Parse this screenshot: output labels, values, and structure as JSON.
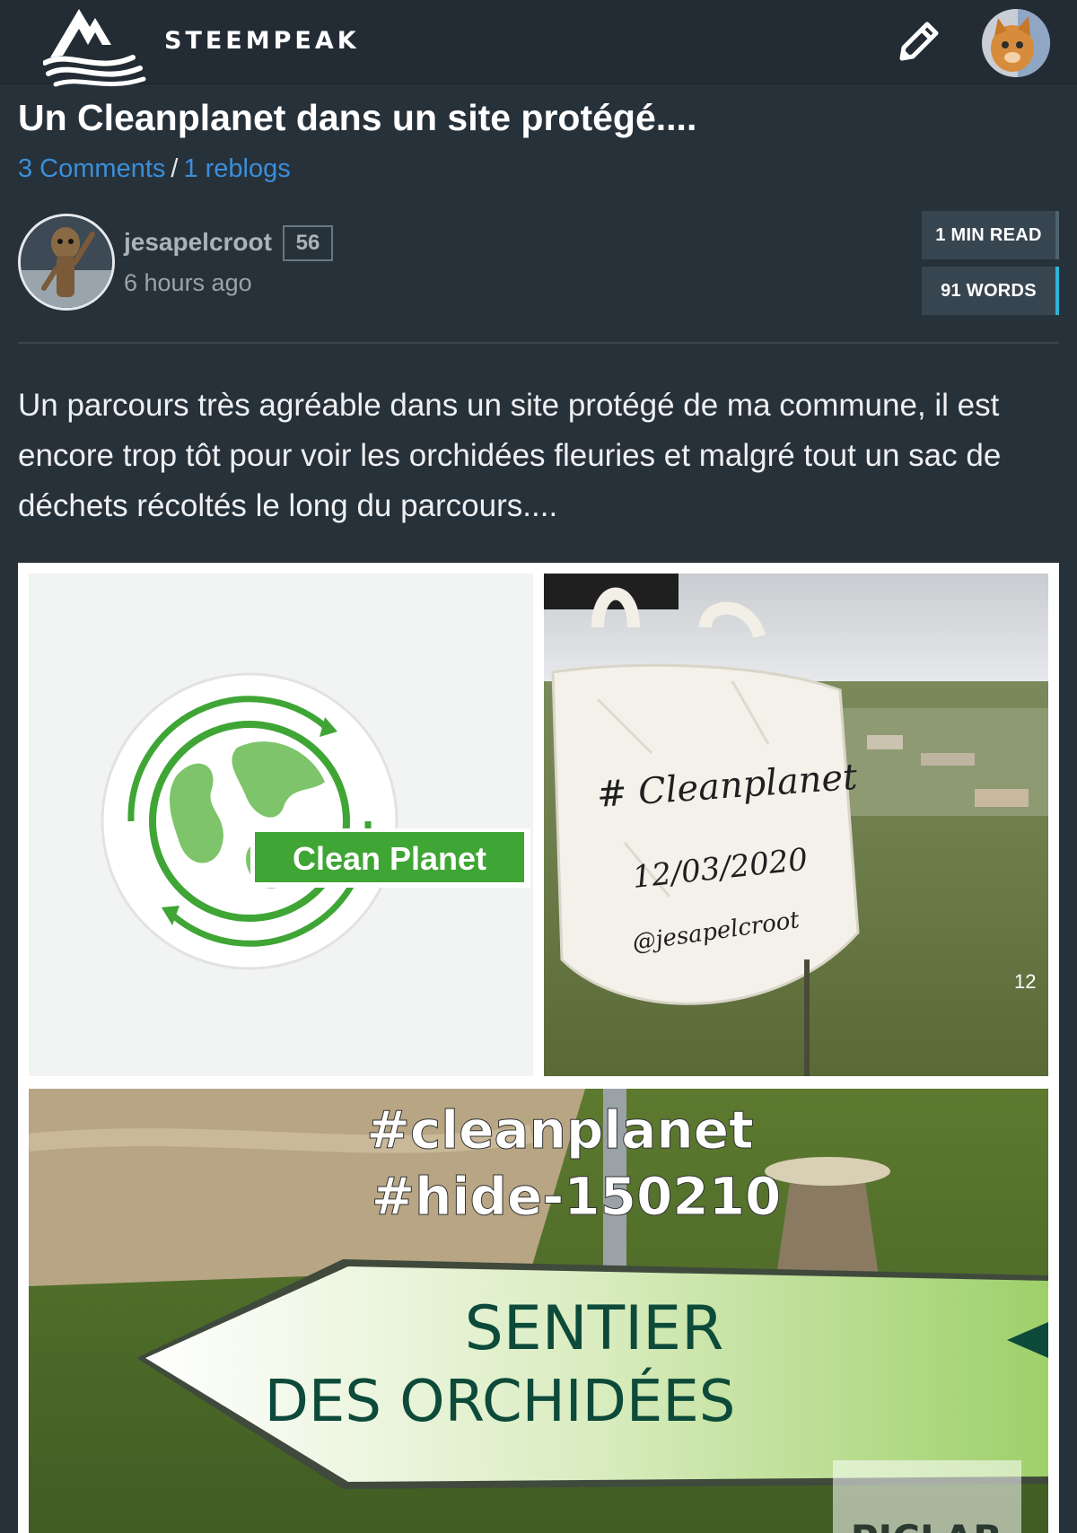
{
  "header": {
    "brand": "STEEMPEAK",
    "logo_icon": "mountain-waves-logo-icon",
    "edit_icon": "pencil-icon",
    "user_avatar": "cat-avatar"
  },
  "post": {
    "title": "Un Cleanplanet dans un site protégé....",
    "comments_link": "3 Comments",
    "separator": "/",
    "reblogs_link": "1 reblogs",
    "author": {
      "name": "jesapelcroot",
      "reputation": "56",
      "time_ago": "6 hours ago"
    },
    "read_time": "1 MIN READ",
    "word_count": "91 WORDS",
    "body": "Un parcours très agréable dans un site protégé de ma commune, il est encore trop tôt pour voir les orchidées fleuries et malgré tout un sac de déchets récoltés le long du parcours...."
  },
  "collage": {
    "logo_text": "Clean Planet",
    "bag_lines": [
      "# Cleanplanet",
      "12/03/2020",
      "@jesapelcroot"
    ],
    "bag_corner_text": "12",
    "hashtags": [
      "#cleanplanet",
      "#hide-150210"
    ],
    "sign_lines": [
      "SENTIER",
      "DES  ORCHIDÉES"
    ],
    "watermark": "PICLAB",
    "colors": {
      "green": "#3fa535",
      "sign_green": "#0d4a3a"
    }
  }
}
